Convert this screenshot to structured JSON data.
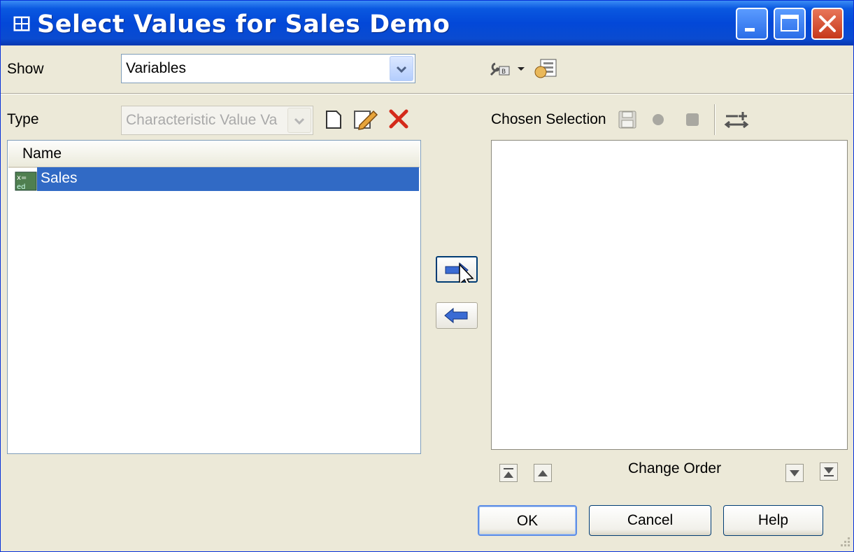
{
  "window": {
    "title": "Select Values for Sales Demo",
    "title_icon": "grid-icon",
    "controls": [
      "minimize-icon",
      "maximize-icon",
      "close-icon"
    ]
  },
  "show": {
    "label": "Show",
    "value": "Variables"
  },
  "type": {
    "label": "Type",
    "value": "Characteristic Value Va",
    "disabled": true
  },
  "list": {
    "header": "Name",
    "items": [
      {
        "label": "Sales",
        "icon": "variable-icon",
        "selected": true
      }
    ]
  },
  "chosen": {
    "label": "Chosen Selection",
    "items": []
  },
  "order": {
    "label": "Change Order"
  },
  "buttons": {
    "ok": "OK",
    "cancel": "Cancel",
    "help": "Help"
  },
  "colors": {
    "titlebar": "#0348d8",
    "selection": "#316ac5",
    "face": "#ece9d8"
  }
}
